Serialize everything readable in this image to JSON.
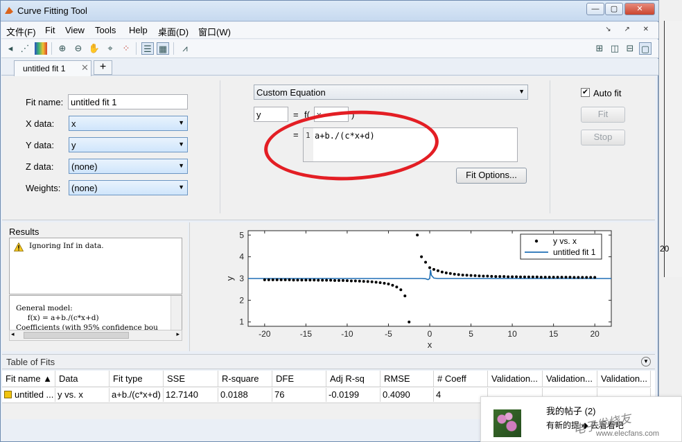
{
  "window": {
    "title": "Curve Fitting Tool"
  },
  "menu": [
    "文件(F)",
    "Fit",
    "View",
    "Tools",
    "Help",
    "桌面(D)",
    "窗口(W)"
  ],
  "toolbar": {
    "icons": [
      "arrow-left-icon",
      "plot-data-icon",
      "color-map-icon",
      "zoom-in-icon",
      "zoom-out-icon",
      "pan-icon",
      "data-cursor-icon",
      "exclude-outliers-icon",
      "legend-icon",
      "grid-icon",
      "residuals-icon"
    ],
    "layout_icons": [
      "layout-quad-icon",
      "layout-columns-icon",
      "layout-rows-icon",
      "layout-single-icon"
    ]
  },
  "tabs": [
    {
      "label": "untitled fit 1"
    }
  ],
  "fit_settings": {
    "fit_name_label": "Fit name:",
    "fit_name_value": "untitled fit 1",
    "x_data_label": "X data:",
    "x_data_value": "x",
    "y_data_label": "Y data:",
    "y_data_value": "y",
    "z_data_label": "Z data:",
    "z_data_value": "(none)",
    "weights_label": "Weights:",
    "weights_value": "(none)",
    "fit_type": "Custom Equation",
    "dependent_var": "y",
    "equals": "=",
    "function_prefix": "f(",
    "independent_var": "x",
    "function_suffix": ")",
    "equation_line_number": "1",
    "equation": "a+b./(c*x+d)",
    "fit_options_label": "Fit Options...",
    "auto_fit_label": "Auto fit",
    "auto_fit_checked": true,
    "fit_button": "Fit",
    "stop_button": "Stop"
  },
  "results": {
    "title": "Results",
    "warning": "Ignoring Inf in data.",
    "general_lines": [
      "General model:",
      "     f(x) = a+b./(c*x+d)",
      "Coefficients (with 95% confidence bou"
    ]
  },
  "chart_data": {
    "type": "scatter",
    "xlabel": "x",
    "ylabel": "y",
    "xlim": [
      -22,
      22
    ],
    "ylim": [
      0.8,
      5.2
    ],
    "xticks": [
      -20,
      -15,
      -10,
      -5,
      0,
      5,
      10,
      15,
      20
    ],
    "yticks": [
      1,
      2,
      3,
      4,
      5
    ],
    "legend": [
      "y vs. x",
      "untitled fit 1"
    ],
    "legend_position": "top-right",
    "colors": {
      "points": "#000000",
      "fit_line": "#1f6fb5"
    },
    "series": [
      {
        "name": "y vs. x",
        "type": "scatter",
        "x": [
          -20,
          -19.5,
          -19,
          -18.5,
          -18,
          -17.5,
          -17,
          -16.5,
          -16,
          -15.5,
          -15,
          -14.5,
          -14,
          -13.5,
          -13,
          -12.5,
          -12,
          -11.5,
          -11,
          -10.5,
          -10,
          -9.5,
          -9,
          -8.5,
          -8,
          -7.5,
          -7,
          -6.5,
          -6,
          -5.5,
          -5,
          -4.5,
          -4,
          -3.5,
          -3,
          -2.5,
          -1.5,
          -1,
          -0.5,
          0,
          0.5,
          1,
          1.5,
          2,
          2.5,
          3,
          3.5,
          4,
          4.5,
          5,
          5.5,
          6,
          6.5,
          7,
          7.5,
          8,
          8.5,
          9,
          9.5,
          10,
          10.5,
          11,
          11.5,
          12,
          12.5,
          13,
          13.5,
          14,
          14.5,
          15,
          15.5,
          16,
          16.5,
          17,
          17.5,
          18,
          18.5,
          19,
          19.5,
          20
        ],
        "y": [
          2.94,
          2.94,
          2.94,
          2.94,
          2.94,
          2.94,
          2.94,
          2.93,
          2.93,
          2.93,
          2.93,
          2.93,
          2.93,
          2.92,
          2.92,
          2.92,
          2.92,
          2.91,
          2.91,
          2.91,
          2.9,
          2.89,
          2.89,
          2.88,
          2.87,
          2.86,
          2.85,
          2.83,
          2.81,
          2.78,
          2.75,
          2.69,
          2.61,
          2.48,
          2.2,
          1.0,
          5.0,
          4.0,
          3.75,
          3.5,
          3.42,
          3.36,
          3.3,
          3.26,
          3.23,
          3.2,
          3.18,
          3.16,
          3.15,
          3.14,
          3.13,
          3.12,
          3.11,
          3.11,
          3.1,
          3.09,
          3.09,
          3.09,
          3.08,
          3.08,
          3.08,
          3.07,
          3.07,
          3.07,
          3.07,
          3.07,
          3.06,
          3.06,
          3.06,
          3.06,
          3.06,
          3.06,
          3.06,
          3.06,
          3.05,
          3.05,
          3.05,
          3.05,
          3.05,
          3.05
        ]
      },
      {
        "name": "untitled fit 1",
        "type": "line",
        "x": [
          -22,
          -1,
          -0.5,
          -0.2,
          0,
          0.1,
          0.2,
          0.5,
          1,
          22
        ],
        "y": [
          3.0,
          3.0,
          2.99,
          2.95,
          3.0,
          3.4,
          3.15,
          3.02,
          3.0,
          3.0
        ]
      }
    ]
  },
  "table_of_fits": {
    "title": "Table of Fits",
    "columns": [
      "Fit name ▲",
      "Data",
      "Fit type",
      "SSE",
      "R-square",
      "DFE",
      "Adj R-sq",
      "RMSE",
      "# Coeff",
      "Validation...",
      "Validation...",
      "Validation..."
    ],
    "rows": [
      [
        "untitled ...",
        "y vs. x",
        "a+b./(c*x+d)",
        "12.7140",
        "0.0188",
        "76",
        "-0.0199",
        "0.4090",
        "4",
        "",
        "",
        ""
      ]
    ]
  },
  "background_window": {
    "tick_label": "20"
  },
  "notification": {
    "title": "我的帖子 (2)",
    "body": "有新的提 ◆ 去看看吧"
  },
  "watermark": {
    "text": "电子发烧友",
    "url": "www.elecfans.com"
  }
}
